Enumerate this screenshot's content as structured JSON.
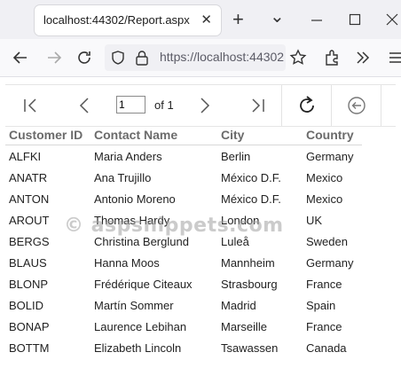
{
  "browser": {
    "tab_title": "localhost:44302/Report.aspx",
    "tab_close": "✕",
    "new_tab": "+",
    "tab_list": "⌄",
    "url_text": "https://localhost:44302"
  },
  "report_toolbar": {
    "page_number": "1",
    "page_of_label": "of 1"
  },
  "table": {
    "headers": [
      "Customer ID",
      "Contact Name",
      "City",
      "Country"
    ],
    "rows": [
      [
        "ALFKI",
        "Maria Anders",
        "Berlin",
        "Germany"
      ],
      [
        "ANATR",
        "Ana Trujillo",
        "México D.F.",
        "Mexico"
      ],
      [
        "ANTON",
        "Antonio Moreno",
        "México D.F.",
        "Mexico"
      ],
      [
        "AROUT",
        "Thomas Hardy",
        "London",
        "UK"
      ],
      [
        "BERGS",
        "Christina Berglund",
        "Luleå",
        "Sweden"
      ],
      [
        "BLAUS",
        "Hanna Moos",
        "Mannheim",
        "Germany"
      ],
      [
        "BLONP",
        "Frédérique Citeaux",
        "Strasbourg",
        "France"
      ],
      [
        "BOLID",
        "Martín Sommer",
        "Madrid",
        "Spain"
      ],
      [
        "BONAP",
        "Laurence Lebihan",
        "Marseille",
        "France"
      ],
      [
        "BOTTM",
        "Elizabeth Lincoln",
        "Tsawassen",
        "Canada"
      ]
    ]
  },
  "watermark": "© aspsnippets.com",
  "colors": {
    "tab_strip": "#f0f0f4",
    "header_text": "#6b6b6b",
    "watermark": "#a0a0a0"
  }
}
